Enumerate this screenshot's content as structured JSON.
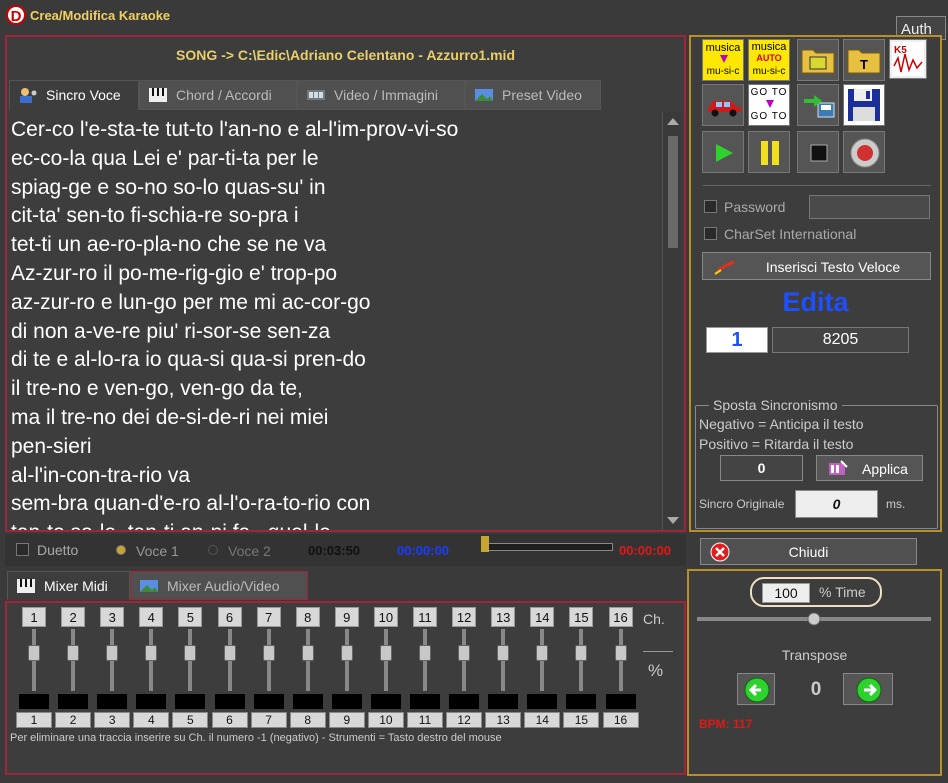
{
  "window": {
    "title": "Crea/Modifica Karaoke",
    "auth": "Auth"
  },
  "song": {
    "path": "SONG -> C:\\Edic\\Adriano Celentano - Azzurro1.mid"
  },
  "tabs": [
    {
      "label": "Sincro Voce"
    },
    {
      "label": "Chord / Accordi"
    },
    {
      "label": "Video / Immagini"
    },
    {
      "label": "Preset Video"
    }
  ],
  "lyrics": [
    "Cer-co l'e-sta-te tut-to l'an-no e al-l'im-prov-vi-so",
    "ec-co-la qua Lei e' par-ti-ta per le",
    "spiag-ge e so-no so-lo quas-su' in",
    "cit-ta' sen-to fi-schia-re so-pra i",
    "tet-ti un ae-ro-pla-no che se ne va",
    "Az-zur-ro il po-me-rig-gio e' trop-po",
    "az-zur-ro e lun-go per me mi ac-cor-go",
    "di non a-ve-re piu' ri-sor-se sen-za",
    "di te e al-lo-ra io qua-si qua-si pren-do",
    "il tre-no e ven-go, ven-go da te,",
    "ma il tre-no dei de-si-de-ri nei miei",
    "pen-sieri",
    "al-l'in-con-tra-rio va",
    "sem-bra quan-d'e-ro al-l'o-ra-to-rio con",
    "tan-to so-le, tan-ti an-ni fa.. quel-le"
  ],
  "transport": {
    "duetto": "Duetto",
    "voce1": "Voce 1",
    "voce2": "Voce 2",
    "time_total": "00:03:50",
    "time_cur": "00:00:00",
    "time_end": "00:00:00",
    "progress": 0.0
  },
  "mixer_tabs": [
    {
      "label": "Mixer Midi"
    },
    {
      "label": "Mixer Audio/Video"
    }
  ],
  "mixer": {
    "channels": [
      "1",
      "2",
      "3",
      "4",
      "5",
      "6",
      "7",
      "8",
      "9",
      "10",
      "11",
      "12",
      "13",
      "14",
      "15",
      "16"
    ],
    "ch_label": "Ch.",
    "pct_label": "%",
    "hint": "Per eliminare una traccia inserire su Ch. il numero -1 (negativo)  -  Strumenti = Tasto destro del mouse"
  },
  "toolbar": {
    "btn_musica_mu": {
      "top": "musica",
      "bottom": "mu-si-c"
    },
    "btn_musica_auto": {
      "top": "musica",
      "mid": "AUTO",
      "bottom": "mu-si-c"
    },
    "btn_goto": {
      "top": "GO TO",
      "bottom": "GO TO"
    }
  },
  "options": {
    "password_label": "Password",
    "password_value": "",
    "charset_label": "CharSet International",
    "insert_fast": "Inserisci Testo Veloce"
  },
  "edit": {
    "title": "Edita",
    "index": "1",
    "value": "8205"
  },
  "sync": {
    "group": "Sposta Sincronismo",
    "neg": "Negativo = Anticipa il testo",
    "pos": "Positivo = Ritarda il testo",
    "offset": "0",
    "apply": "Applica",
    "orig_label": "Sincro Originale",
    "orig_value": "0",
    "ms": "ms."
  },
  "close": {
    "label": "Chiudi"
  },
  "tempo": {
    "value": "100",
    "label": "% Time",
    "slider": 0.5
  },
  "transpose": {
    "label": "Transpose",
    "value": "0",
    "bpm": "BPM: 117"
  },
  "colors": {
    "accent_red": "#a0243a",
    "accent_gold": "#b8902a",
    "edit_blue": "#1e4fff",
    "bpm_red": "#e01818"
  }
}
